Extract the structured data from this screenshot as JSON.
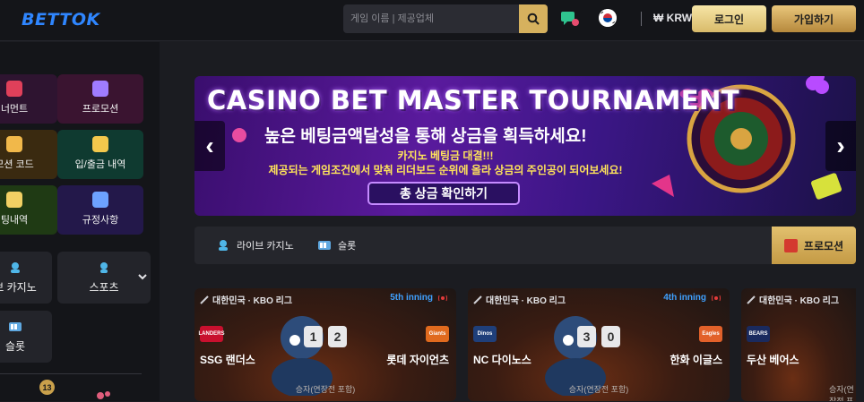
{
  "header": {
    "logo": "BETTOK",
    "search_placeholder": "게임 이름 | 제공업체",
    "currency": "₩ KRW",
    "login_label": "로그인",
    "join_label": "가입하기"
  },
  "sidebar": {
    "tiles": [
      {
        "label": "너먼트",
        "color": "#3a1430",
        "icon_color": "#e0405a"
      },
      {
        "label": "프로모션",
        "color": "#3a1430",
        "icon_color": "#9f7cff"
      },
      {
        "label": "모션 코드",
        "color": "#3a2a10",
        "icon_color": "#f1b84a"
      },
      {
        "label": "입/출금 내역",
        "color": "#0f3a30",
        "icon_color": "#f3c84c"
      },
      {
        "label": "팅내역",
        "color": "#1f3a14",
        "icon_color": "#f1d064"
      },
      {
        "label": "규정사항",
        "color": "#23184a",
        "icon_color": "#6da2ff"
      }
    ],
    "games": [
      {
        "label": "브 카지노"
      },
      {
        "label": "스포츠"
      },
      {
        "label": "슬롯"
      }
    ],
    "badge_count": "13"
  },
  "banner": {
    "title": "CASINO BET MASTER TOURNAMENT",
    "subtitle": "높은 베팅금액달성을 통해 상금을 획득하세요!",
    "line3": "카지노 베팅금 대결!!!",
    "line4": "제공되는 게임조건에서 맞춰 리더보드 순위에 올라 상금의 주인공이 되어보세요!",
    "cta": "총 상금 확인하기"
  },
  "tabs": [
    {
      "label": "라이브 카지노"
    },
    {
      "label": "슬롯"
    }
  ],
  "promo_tab_label": "프로모션",
  "matches": [
    {
      "league": "대한민국 · KBO 리그",
      "inning": "5th inning",
      "home": "SSG 랜더스",
      "away": "롯데 자이언츠",
      "home_score": "1",
      "away_score": "2",
      "home_logo": "LANDERS",
      "home_logo_color": "#c8102e",
      "away_logo": "Giants",
      "away_logo_color": "#e06a1e",
      "winner_text": "승자(연장전 포함)"
    },
    {
      "league": "대한민국 · KBO 리그",
      "inning": "4th inning",
      "home": "NC 다이노스",
      "away": "한화 이글스",
      "home_score": "3",
      "away_score": "0",
      "home_logo": "Dinos",
      "home_logo_color": "#1f3f7a",
      "away_logo": "Eagles",
      "away_logo_color": "#e2612a",
      "winner_text": "승자(연장전 포함)"
    },
    {
      "league": "대한민국 · KBO 리그",
      "inning": "",
      "home": "두산 베어스",
      "away": "",
      "home_score": "",
      "away_score": "",
      "home_logo": "BEARS",
      "home_logo_color": "#1a2a5e",
      "away_logo": "",
      "away_logo_color": "",
      "winner_text": "승자(연장전 포함)"
    }
  ]
}
